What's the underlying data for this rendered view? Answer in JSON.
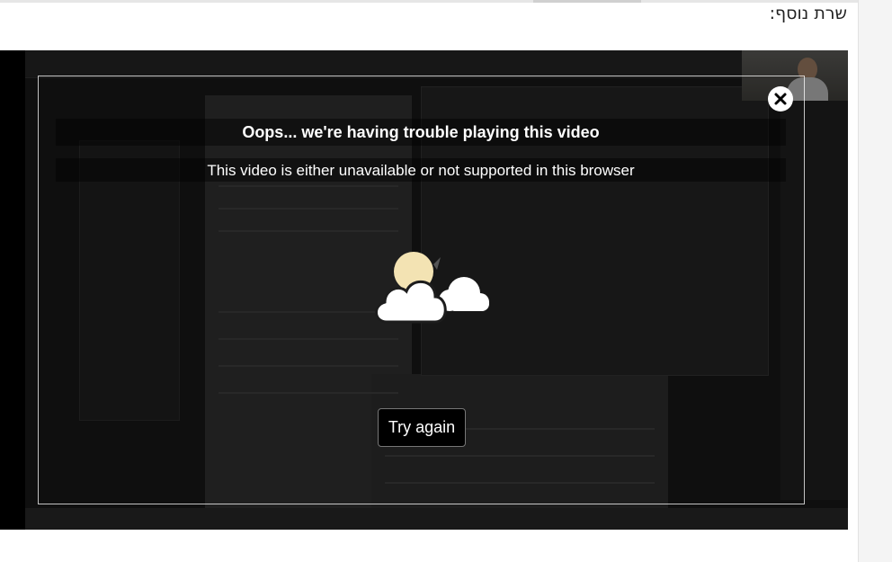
{
  "page": {
    "heading": "שרת נוסף:"
  },
  "video_error": {
    "title": "Oops... we're having trouble playing this video",
    "message": "This video is either unavailable or not supported in this browser",
    "retry_label": "Try again"
  },
  "icons": {
    "close": "close-icon",
    "weather": "cloud-sun-icon"
  },
  "colors": {
    "error_text": "#ffffff",
    "player_bg": "#000000",
    "sun": "#f3e3b3"
  }
}
